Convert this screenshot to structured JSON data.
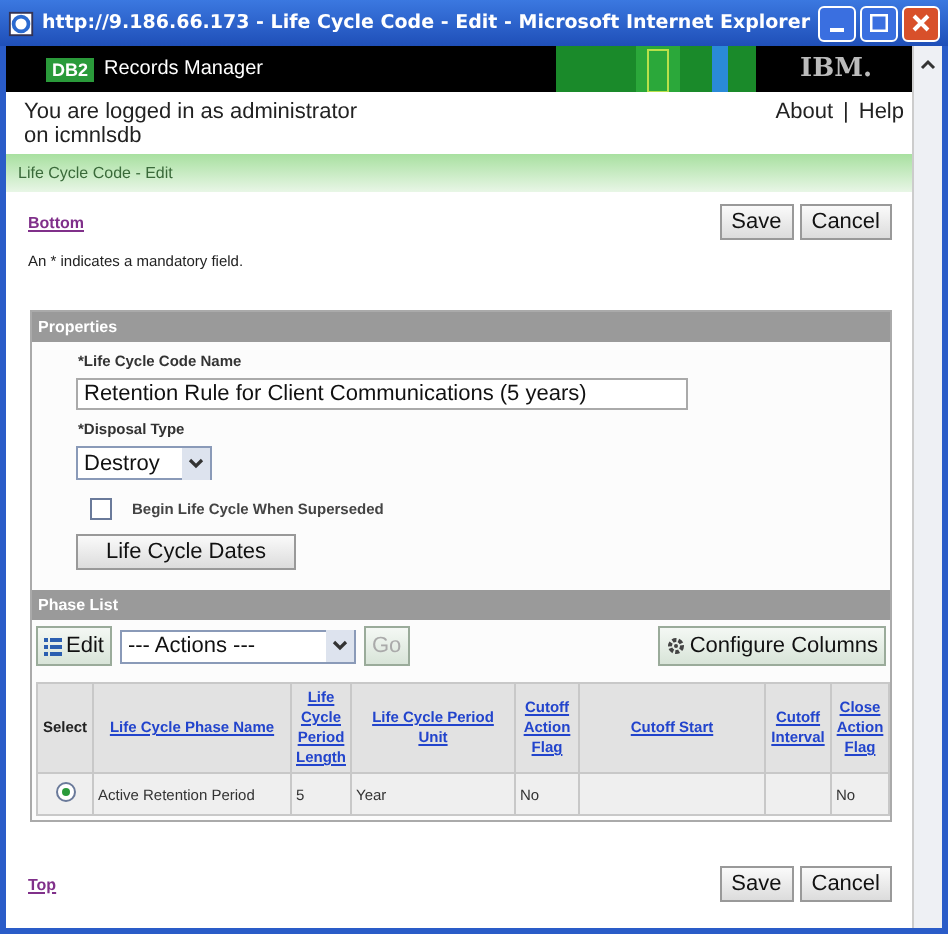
{
  "window": {
    "title": "http://9.186.66.173 - Life Cycle Code - Edit - Microsoft Internet Explorer"
  },
  "banner": {
    "badge": "DB2",
    "product": "Records Manager",
    "brand": "IBM."
  },
  "login": {
    "text": "You are logged in as administrator on icmnlsdb",
    "links": [
      "About",
      "Help"
    ],
    "separator": "|"
  },
  "breadcrumb": "Life Cycle Code - Edit",
  "top_nav": {
    "link": "Bottom",
    "buttons": [
      "Save",
      "Cancel"
    ]
  },
  "note": "An * indicates a mandatory field.",
  "properties": {
    "title": "Properties",
    "name_label": "*Life Cycle Code Name",
    "name_value": "Retention Rule for Client Communications (5 years)",
    "disposal_label": "*Disposal Type",
    "disposal_value": "Destroy",
    "checkbox": {
      "label": "Begin Life Cycle When Superseded",
      "checked": false
    },
    "dates_button": "Life Cycle Dates"
  },
  "phase_list": {
    "title": "Phase List",
    "edit_button": "Edit",
    "actions": "--- Actions ---",
    "go_button": "Go",
    "go_disabled": true,
    "configure_button": "Configure Columns",
    "columns": [
      "Select",
      "Life Cycle Phase Name",
      "Life Cycle Period Length",
      "Life Cycle Period Unit",
      "Cutoff Action Flag",
      "Cutoff Start",
      "Cutoff Interval",
      "Close Action Flag"
    ],
    "rows": [
      {
        "selected": true,
        "cells": [
          "",
          "Active Retention Period",
          "5",
          "Year",
          "No",
          "",
          "",
          "No"
        ]
      }
    ]
  },
  "bottom_nav": {
    "link": "Top",
    "buttons": [
      "Save",
      "Cancel"
    ]
  }
}
